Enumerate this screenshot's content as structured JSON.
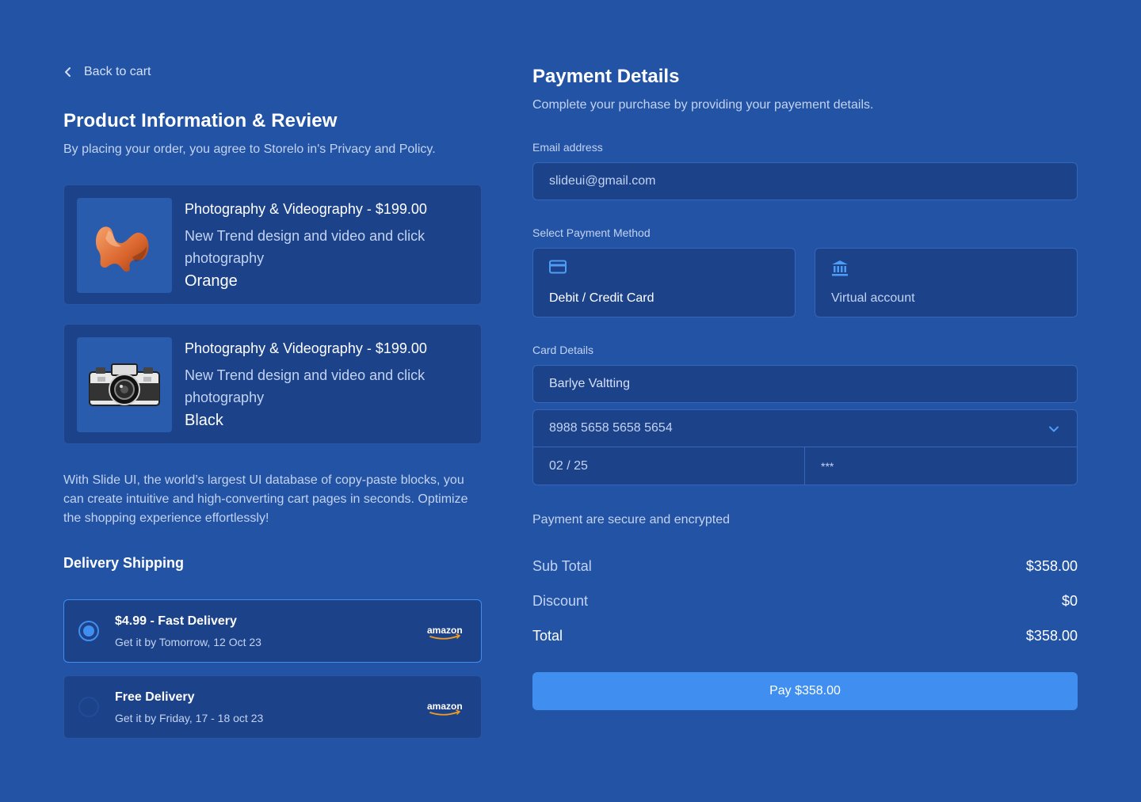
{
  "colors": {
    "background": "#2353a4",
    "card": "#1c428a",
    "accent": "#3f8ef0"
  },
  "back": {
    "label": "Back to cart",
    "icon": "chevron-left-icon"
  },
  "review": {
    "title": "Product Information & Review",
    "subtitle": "By placing your order, you agree to Storelo in's Privacy and Policy.",
    "products": [
      {
        "title": "Photography & Videography - $199.00",
        "description": "New Trend design and video and click photography",
        "color": "Orange",
        "image": "orange-chair"
      },
      {
        "title": "Photography & Videography - $199.00",
        "description": "New Trend design and video and click photography",
        "color": "Black",
        "image": "vintage-camera"
      }
    ],
    "paragraph": "With Slide UI, the world’s largest UI database of copy-paste blocks, you can create intuitive and high-converting cart pages in seconds. Optimize the shopping experience effortlessly!"
  },
  "delivery": {
    "title": "Delivery Shipping",
    "options": [
      {
        "title": "$4.99 - Fast Delivery",
        "date": "Get it by Tomorrow, 12 Oct 23",
        "carrier": "amazon",
        "selected": true
      },
      {
        "title": "Free Delivery",
        "date": "Get it by Friday, 17 - 18 oct 23",
        "carrier": "amazon",
        "selected": false
      }
    ]
  },
  "payment": {
    "title": "Payment Details",
    "subtitle": "Complete your purchase by providing your payement details.",
    "email_label": "Email address",
    "email_value": "slideui@gmail.com",
    "method_label": "Select Payment Method",
    "methods": [
      {
        "label": "Debit / Credit Card",
        "icon": "credit-card-icon"
      },
      {
        "label": "Virtual account",
        "icon": "bank-icon"
      }
    ],
    "card_label": "Card Details",
    "card_name": "Barlye Valtting",
    "card_number": "8988 5658 5658 5654",
    "card_expiry": "02 / 25",
    "card_cvc": "***",
    "secure_text": "Payment are secure and encrypted"
  },
  "summary": {
    "subtotal_label": "Sub Total",
    "subtotal_value": "$358.00",
    "discount_label": "Discount",
    "discount_value": "$0",
    "total_label": "Total",
    "total_value": "$358.00"
  },
  "pay_button": "Pay $358.00"
}
